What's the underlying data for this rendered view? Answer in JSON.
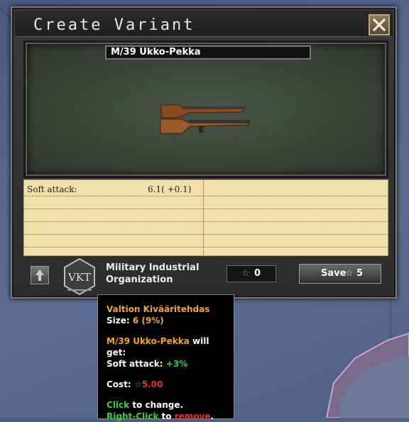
{
  "window": {
    "title": "Create Variant"
  },
  "variant": {
    "name": "M/39 Ukko-Pekka"
  },
  "stats": [
    {
      "label": "Soft attack:",
      "value": "6.1( +0.1)"
    }
  ],
  "mio": {
    "line1": "Military Industrial",
    "line2": "Organization",
    "badge_text": "VKT"
  },
  "cost_box": {
    "value": "0"
  },
  "save": {
    "label": "Save",
    "value": "5"
  },
  "tooltip": {
    "org_name": "Valtion Kivääritehdas",
    "size_label": "Size:",
    "size_value": "6",
    "size_pct": "(9%)",
    "variant_name": "M/39 Ukko-Pekka",
    "will_get": "will get:",
    "bonus_label": "Soft attack:",
    "bonus_value": "+3%",
    "cost_label": "Cost:",
    "cost_value": "5.00",
    "click": "Click",
    "click_rest": "to change.",
    "right_click": "Right-Click",
    "right_click_mid": "to",
    "remove": "remove",
    "remove_end": "."
  },
  "colors": {
    "accent_gold": "#f0a818",
    "positive": "#36d036",
    "negative": "#e83030",
    "paper": "#f1dfaa"
  }
}
